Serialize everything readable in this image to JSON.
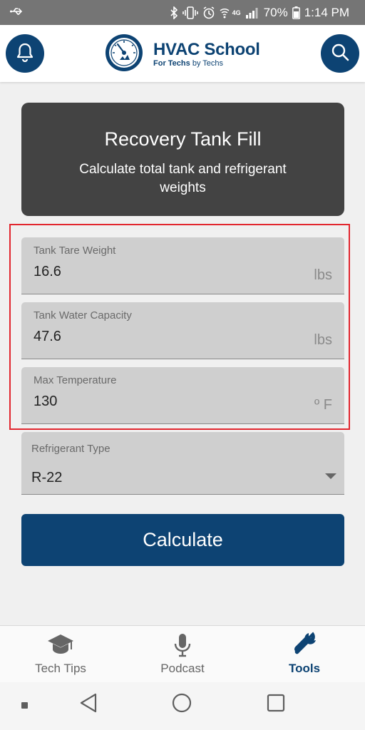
{
  "status_bar": {
    "battery_percent": "70%",
    "time": "1:14 PM",
    "network": "4G"
  },
  "header": {
    "brand_title": "HVAC School",
    "brand_tagline_prefix": "For Techs",
    "brand_tagline_suffix": " by Techs",
    "left_icon": "bell-icon",
    "right_icon": "search-icon"
  },
  "calculator": {
    "title": "Recovery Tank Fill",
    "subtitle": "Calculate total tank and refrigerant weights"
  },
  "fields": [
    {
      "label": "Tank Tare Weight",
      "value": "16.6",
      "unit": "lbs"
    },
    {
      "label": "Tank Water Capacity",
      "value": "47.6",
      "unit": "lbs"
    },
    {
      "label": "Max Temperature",
      "value": "130",
      "unit": "º F"
    }
  ],
  "refrigerant": {
    "label": "Refrigerant Type",
    "selected": "R-22"
  },
  "calculate_label": "Calculate",
  "bottom_nav": [
    {
      "label": "Tech Tips",
      "icon": "graduation-cap-icon",
      "active": false
    },
    {
      "label": "Podcast",
      "icon": "microphone-icon",
      "active": false
    },
    {
      "label": "Tools",
      "icon": "wrench-icon",
      "active": true
    }
  ],
  "colors": {
    "brand_blue": "#0d4373",
    "title_card_bg": "#434343",
    "highlight_red": "#e2262e",
    "field_bg": "#cfcfcf"
  }
}
